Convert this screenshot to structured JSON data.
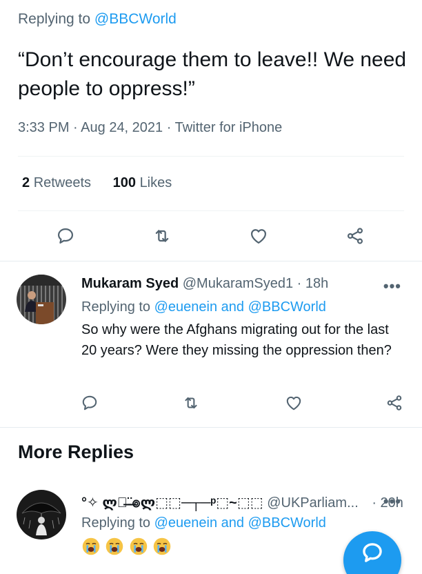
{
  "main_tweet": {
    "replying_prefix": "Replying to",
    "replying_handle": "@BBCWorld",
    "text": "“Don’t encourage them to leave!! We need people to oppress!”",
    "time": "3:33 PM",
    "date": "Aug 24, 2021",
    "source": "Twitter for iPhone",
    "separator": "·",
    "retweets_count": "2",
    "retweets_label": "Retweets",
    "likes_count": "100",
    "likes_label": "Likes"
  },
  "reply_1": {
    "name": "Mukaram Syed",
    "handle": "@MukaramSyed1",
    "age": "· 18h",
    "replying_prefix": "Replying to",
    "replying_to": "@euenein and @BBCWorld",
    "text": "So why were the Afghans migrating out for the last 20 years? Were they missing the oppression then?",
    "more": "•••"
  },
  "more_replies": {
    "title": "More Replies"
  },
  "reply_2": {
    "name": "°✧ ლ๏̶¨̶๏ლ⬚⬚─┬─ᵖ⬚~⬚⬚",
    "handle": "@UKParliam...",
    "age": "· 20h",
    "replying_prefix": "Replying to",
    "replying_to": "@euenein and @BBCWorld",
    "more": "•••"
  },
  "icons": {
    "reply": "reply-icon",
    "retweet": "retweet-icon",
    "like": "heart-icon",
    "share": "share-icon",
    "compose": "compose-reply-icon",
    "emoji": "loudly-crying-face-emoji"
  },
  "colors": {
    "accent": "#1d9bf0",
    "secondary_text": "#536471",
    "primary_text": "#0f1419"
  }
}
